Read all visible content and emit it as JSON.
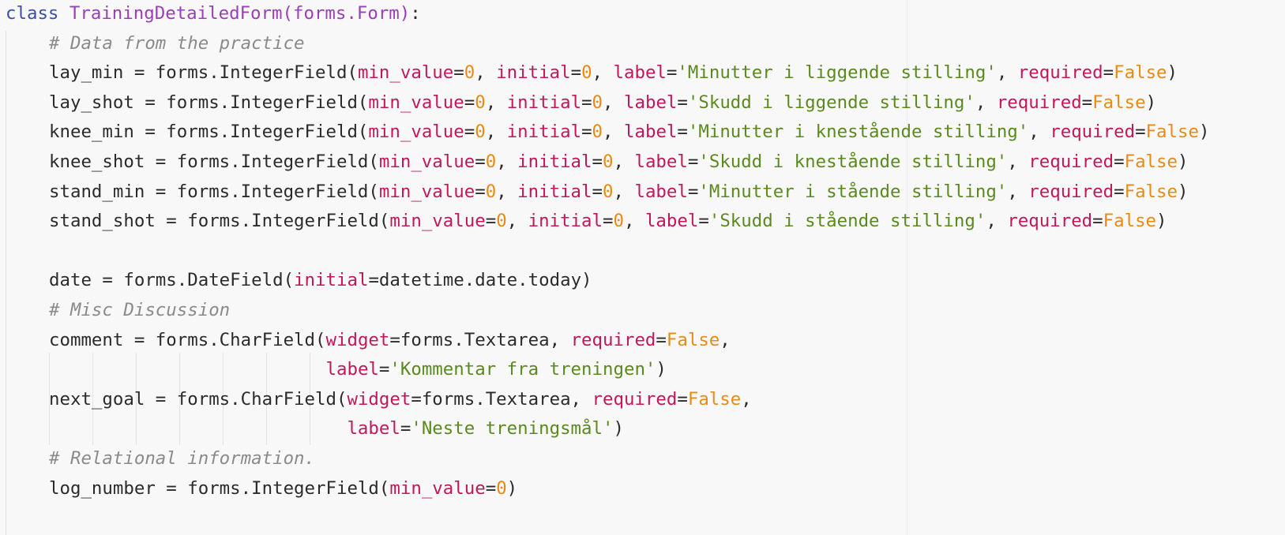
{
  "code": {
    "language": "python",
    "lines": [
      {
        "indent": 0,
        "tokens": [
          [
            "kw",
            "class "
          ],
          [
            "cls",
            "TrainingDetailedForm"
          ],
          [
            "cls",
            "(forms.Form)"
          ],
          [
            "txt",
            ":"
          ]
        ]
      },
      {
        "indent": 1,
        "tokens": [
          [
            "cm",
            "# Data from the practice"
          ]
        ]
      },
      {
        "indent": 1,
        "tokens": [
          [
            "txt",
            "lay_min = forms.IntegerField("
          ],
          [
            "kwa",
            "min_value"
          ],
          [
            "txt",
            "="
          ],
          [
            "num",
            "0"
          ],
          [
            "txt",
            ", "
          ],
          [
            "kwa",
            "initial"
          ],
          [
            "txt",
            "="
          ],
          [
            "num",
            "0"
          ],
          [
            "txt",
            ", "
          ],
          [
            "kwa",
            "label"
          ],
          [
            "txt",
            "="
          ],
          [
            "str",
            "'Minutter i liggende stilling'"
          ],
          [
            "txt",
            ", "
          ],
          [
            "kwa",
            "required"
          ],
          [
            "txt",
            "="
          ],
          [
            "num",
            "False"
          ],
          [
            "txt",
            ")"
          ]
        ]
      },
      {
        "indent": 1,
        "tokens": [
          [
            "txt",
            "lay_shot = forms.IntegerField("
          ],
          [
            "kwa",
            "min_value"
          ],
          [
            "txt",
            "="
          ],
          [
            "num",
            "0"
          ],
          [
            "txt",
            ", "
          ],
          [
            "kwa",
            "initial"
          ],
          [
            "txt",
            "="
          ],
          [
            "num",
            "0"
          ],
          [
            "txt",
            ", "
          ],
          [
            "kwa",
            "label"
          ],
          [
            "txt",
            "="
          ],
          [
            "str",
            "'Skudd i liggende stilling'"
          ],
          [
            "txt",
            ", "
          ],
          [
            "kwa",
            "required"
          ],
          [
            "txt",
            "="
          ],
          [
            "num",
            "False"
          ],
          [
            "txt",
            ")"
          ]
        ]
      },
      {
        "indent": 1,
        "tokens": [
          [
            "txt",
            "knee_min = forms.IntegerField("
          ],
          [
            "kwa",
            "min_value"
          ],
          [
            "txt",
            "="
          ],
          [
            "num",
            "0"
          ],
          [
            "txt",
            ", "
          ],
          [
            "kwa",
            "initial"
          ],
          [
            "txt",
            "="
          ],
          [
            "num",
            "0"
          ],
          [
            "txt",
            ", "
          ],
          [
            "kwa",
            "label"
          ],
          [
            "txt",
            "="
          ],
          [
            "str",
            "'Minutter i knestående stilling'"
          ],
          [
            "txt",
            ", "
          ],
          [
            "kwa",
            "required"
          ],
          [
            "txt",
            "="
          ],
          [
            "num",
            "False"
          ],
          [
            "txt",
            ")"
          ]
        ]
      },
      {
        "indent": 1,
        "tokens": [
          [
            "txt",
            "knee_shot = forms.IntegerField("
          ],
          [
            "kwa",
            "min_value"
          ],
          [
            "txt",
            "="
          ],
          [
            "num",
            "0"
          ],
          [
            "txt",
            ", "
          ],
          [
            "kwa",
            "initial"
          ],
          [
            "txt",
            "="
          ],
          [
            "num",
            "0"
          ],
          [
            "txt",
            ", "
          ],
          [
            "kwa",
            "label"
          ],
          [
            "txt",
            "="
          ],
          [
            "str",
            "'Skudd i knestående stilling'"
          ],
          [
            "txt",
            ", "
          ],
          [
            "kwa",
            "required"
          ],
          [
            "txt",
            "="
          ],
          [
            "num",
            "False"
          ],
          [
            "txt",
            ")"
          ]
        ]
      },
      {
        "indent": 1,
        "tokens": [
          [
            "txt",
            "stand_min = forms.IntegerField("
          ],
          [
            "kwa",
            "min_value"
          ],
          [
            "txt",
            "="
          ],
          [
            "num",
            "0"
          ],
          [
            "txt",
            ", "
          ],
          [
            "kwa",
            "initial"
          ],
          [
            "txt",
            "="
          ],
          [
            "num",
            "0"
          ],
          [
            "txt",
            ", "
          ],
          [
            "kwa",
            "label"
          ],
          [
            "txt",
            "="
          ],
          [
            "str",
            "'Minutter i stående stilling'"
          ],
          [
            "txt",
            ", "
          ],
          [
            "kwa",
            "required"
          ],
          [
            "txt",
            "="
          ],
          [
            "num",
            "False"
          ],
          [
            "txt",
            ")"
          ]
        ]
      },
      {
        "indent": 1,
        "tokens": [
          [
            "txt",
            "stand_shot = forms.IntegerField("
          ],
          [
            "kwa",
            "min_value"
          ],
          [
            "txt",
            "="
          ],
          [
            "num",
            "0"
          ],
          [
            "txt",
            ", "
          ],
          [
            "kwa",
            "initial"
          ],
          [
            "txt",
            "="
          ],
          [
            "num",
            "0"
          ],
          [
            "txt",
            ", "
          ],
          [
            "kwa",
            "label"
          ],
          [
            "txt",
            "="
          ],
          [
            "str",
            "'Skudd i stående stilling'"
          ],
          [
            "txt",
            ", "
          ],
          [
            "kwa",
            "required"
          ],
          [
            "txt",
            "="
          ],
          [
            "num",
            "False"
          ],
          [
            "txt",
            ")"
          ]
        ]
      },
      {
        "indent": 0,
        "tokens": []
      },
      {
        "indent": 1,
        "tokens": [
          [
            "txt",
            "date = forms.DateField("
          ],
          [
            "kwa",
            "initial"
          ],
          [
            "txt",
            "=datetime.date.today)"
          ]
        ]
      },
      {
        "indent": 1,
        "tokens": [
          [
            "cm",
            "# Misc Discussion"
          ]
        ]
      },
      {
        "indent": 1,
        "tokens": [
          [
            "txt",
            "comment = forms.CharField("
          ],
          [
            "kwa",
            "widget"
          ],
          [
            "txt",
            "=forms.Textarea, "
          ],
          [
            "kwa",
            "required"
          ],
          [
            "txt",
            "="
          ],
          [
            "num",
            "False"
          ],
          [
            "txt",
            ","
          ]
        ]
      },
      {
        "indent": 1,
        "tokens": [
          [
            "txt",
            "                          "
          ],
          [
            "kwa",
            "label"
          ],
          [
            "txt",
            "="
          ],
          [
            "str",
            "'Kommentar fra treningen'"
          ],
          [
            "txt",
            ")"
          ]
        ]
      },
      {
        "indent": 1,
        "tokens": [
          [
            "txt",
            "next_goal = forms.CharField("
          ],
          [
            "kwa",
            "widget"
          ],
          [
            "txt",
            "=forms.Textarea, "
          ],
          [
            "kwa",
            "required"
          ],
          [
            "txt",
            "="
          ],
          [
            "num",
            "False"
          ],
          [
            "txt",
            ","
          ]
        ]
      },
      {
        "indent": 1,
        "tokens": [
          [
            "txt",
            "                            "
          ],
          [
            "kwa",
            "label"
          ],
          [
            "txt",
            "="
          ],
          [
            "str",
            "'Neste treningsmål'"
          ],
          [
            "txt",
            ")"
          ]
        ]
      },
      {
        "indent": 1,
        "tokens": [
          [
            "cm",
            "# Relational information."
          ]
        ]
      },
      {
        "indent": 1,
        "tokens": [
          [
            "txt",
            "log_number = forms.IntegerField("
          ],
          [
            "kwa",
            "min_value"
          ],
          [
            "txt",
            "="
          ],
          [
            "num",
            "0"
          ],
          [
            "txt",
            ")"
          ]
        ]
      }
    ]
  }
}
